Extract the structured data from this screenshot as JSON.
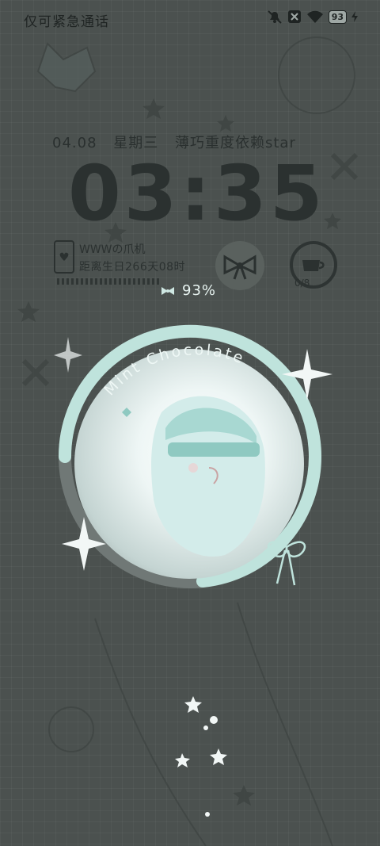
{
  "status_bar": {
    "carrier": "仅可紧急通话",
    "battery": "93",
    "icons": [
      "mute-bell-icon",
      "x-badge-icon",
      "wifi-icon",
      "battery-icon",
      "charging-bolt-icon"
    ]
  },
  "lock": {
    "date": "04.08",
    "weekday": "星期三",
    "motto": "薄巧重度依赖star",
    "time": "03:35"
  },
  "widget": {
    "owner": "WWWの爪机",
    "birthday": "距离生日266天08时",
    "cup_count": "0/8"
  },
  "battery": {
    "percent": "93%"
  },
  "artwork": {
    "title": "Mint Chocolate"
  },
  "colors": {
    "background": "#4b514f",
    "accent": "#bfe3dc",
    "text": "#2b3130"
  }
}
